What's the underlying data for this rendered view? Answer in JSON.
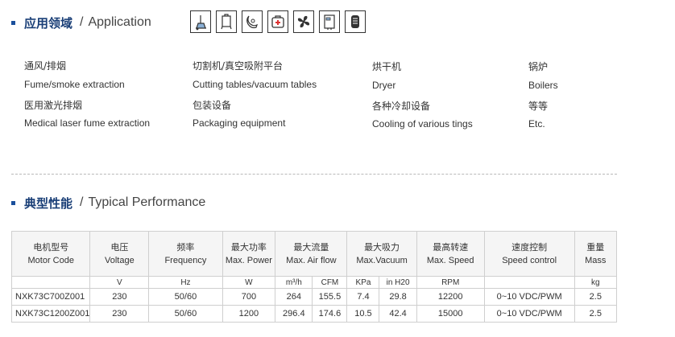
{
  "application": {
    "title_cn": "应用领域",
    "title_en": "Application",
    "icons": [
      "vacuum-cleaner-icon",
      "cutting-table-icon",
      "dryer-icon",
      "medical-kit-icon",
      "fan-icon",
      "boiler-icon",
      "cooling-icon"
    ],
    "columns": [
      {
        "items": [
          "通风/排烟",
          "Fume/smoke extraction",
          "医用激光排烟",
          "Medical laser fume extraction"
        ]
      },
      {
        "items": [
          "切割机/真空吸附平台",
          "Cutting tables/vacuum tables",
          "包装设备",
          "Packaging equipment"
        ]
      },
      {
        "items": [
          "烘干机",
          "Dryer",
          "各种冷却设备",
          "Cooling of various tings"
        ]
      },
      {
        "items": [
          "锅炉",
          "Boilers",
          "等等",
          "Etc."
        ]
      }
    ]
  },
  "performance": {
    "title_cn": "典型性能",
    "title_en": "Typical Performance",
    "headers": [
      {
        "cn": "电机型号",
        "en": "Motor Code"
      },
      {
        "cn": "电压",
        "en": "Voltage"
      },
      {
        "cn": "频率",
        "en": "Frequency"
      },
      {
        "cn": "最大功率",
        "en": "Max. Power"
      },
      {
        "cn": "最大流量",
        "en": "Max. Air flow"
      },
      {
        "cn": "最大吸力",
        "en": "Max.Vacuum"
      },
      {
        "cn": "最高转速",
        "en": "Max. Speed"
      },
      {
        "cn": "速度控制",
        "en": "Speed control"
      },
      {
        "cn": "重量",
        "en": "Mass"
      }
    ],
    "units": [
      "",
      "V",
      "Hz",
      "W",
      "m³/h",
      "CFM",
      "KPa",
      "in H20",
      "RPM",
      "",
      "kg"
    ],
    "rows": [
      [
        "NXK73C700Z001",
        "230",
        "50/60",
        "700",
        "264",
        "155.5",
        "7.4",
        "29.8",
        "12200",
        "0~10 VDC/PWM",
        "2.5"
      ],
      [
        "NXK73C1200Z001",
        "230",
        "50/60",
        "1200",
        "296.4",
        "174.6",
        "10.5",
        "42.4",
        "15000",
        "0~10 VDC/PWM",
        "2.5"
      ]
    ]
  },
  "colors": {
    "accent": "#1a4f9c",
    "heading": "#1a3f77",
    "border": "#cfcfcf"
  }
}
